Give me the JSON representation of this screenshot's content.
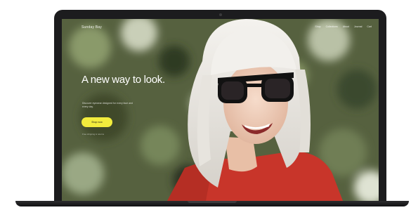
{
  "site": {
    "logo": "Sunday Bay",
    "nav": [
      "Shop",
      "Collections",
      "About",
      "Journal",
      "Cart"
    ]
  },
  "hero": {
    "headline": "A new way to look.",
    "subtext": "Discover eyewear designed for every face and every day.",
    "cta_label": "Shop now",
    "note": "Free shipping & returns"
  },
  "colors": {
    "cta": "#f2ec3d",
    "bezel": "#1c1c1e",
    "hair": "#e8e6e2",
    "top": "#c8352a"
  }
}
